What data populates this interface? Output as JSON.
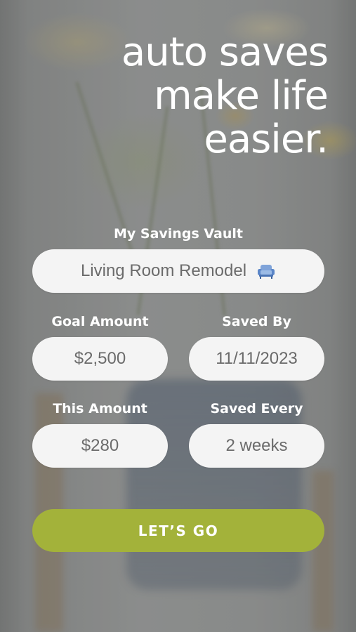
{
  "headline": {
    "line1": "auto saves",
    "line2": "make life",
    "line3": "easier."
  },
  "vault": {
    "label": "My Savings Vault",
    "value": "Living Room Remodel",
    "icon": "sofa-icon"
  },
  "goal_amount": {
    "label": "Goal Amount",
    "value": "$2,500"
  },
  "saved_by": {
    "label": "Saved By",
    "value": "11/11/2023"
  },
  "this_amount": {
    "label": "This Amount",
    "value": "$280"
  },
  "saved_every": {
    "label": "Saved Every",
    "value": "2 weeks"
  },
  "cta": {
    "label": "LET’S GO",
    "color": "#a3b23a"
  }
}
